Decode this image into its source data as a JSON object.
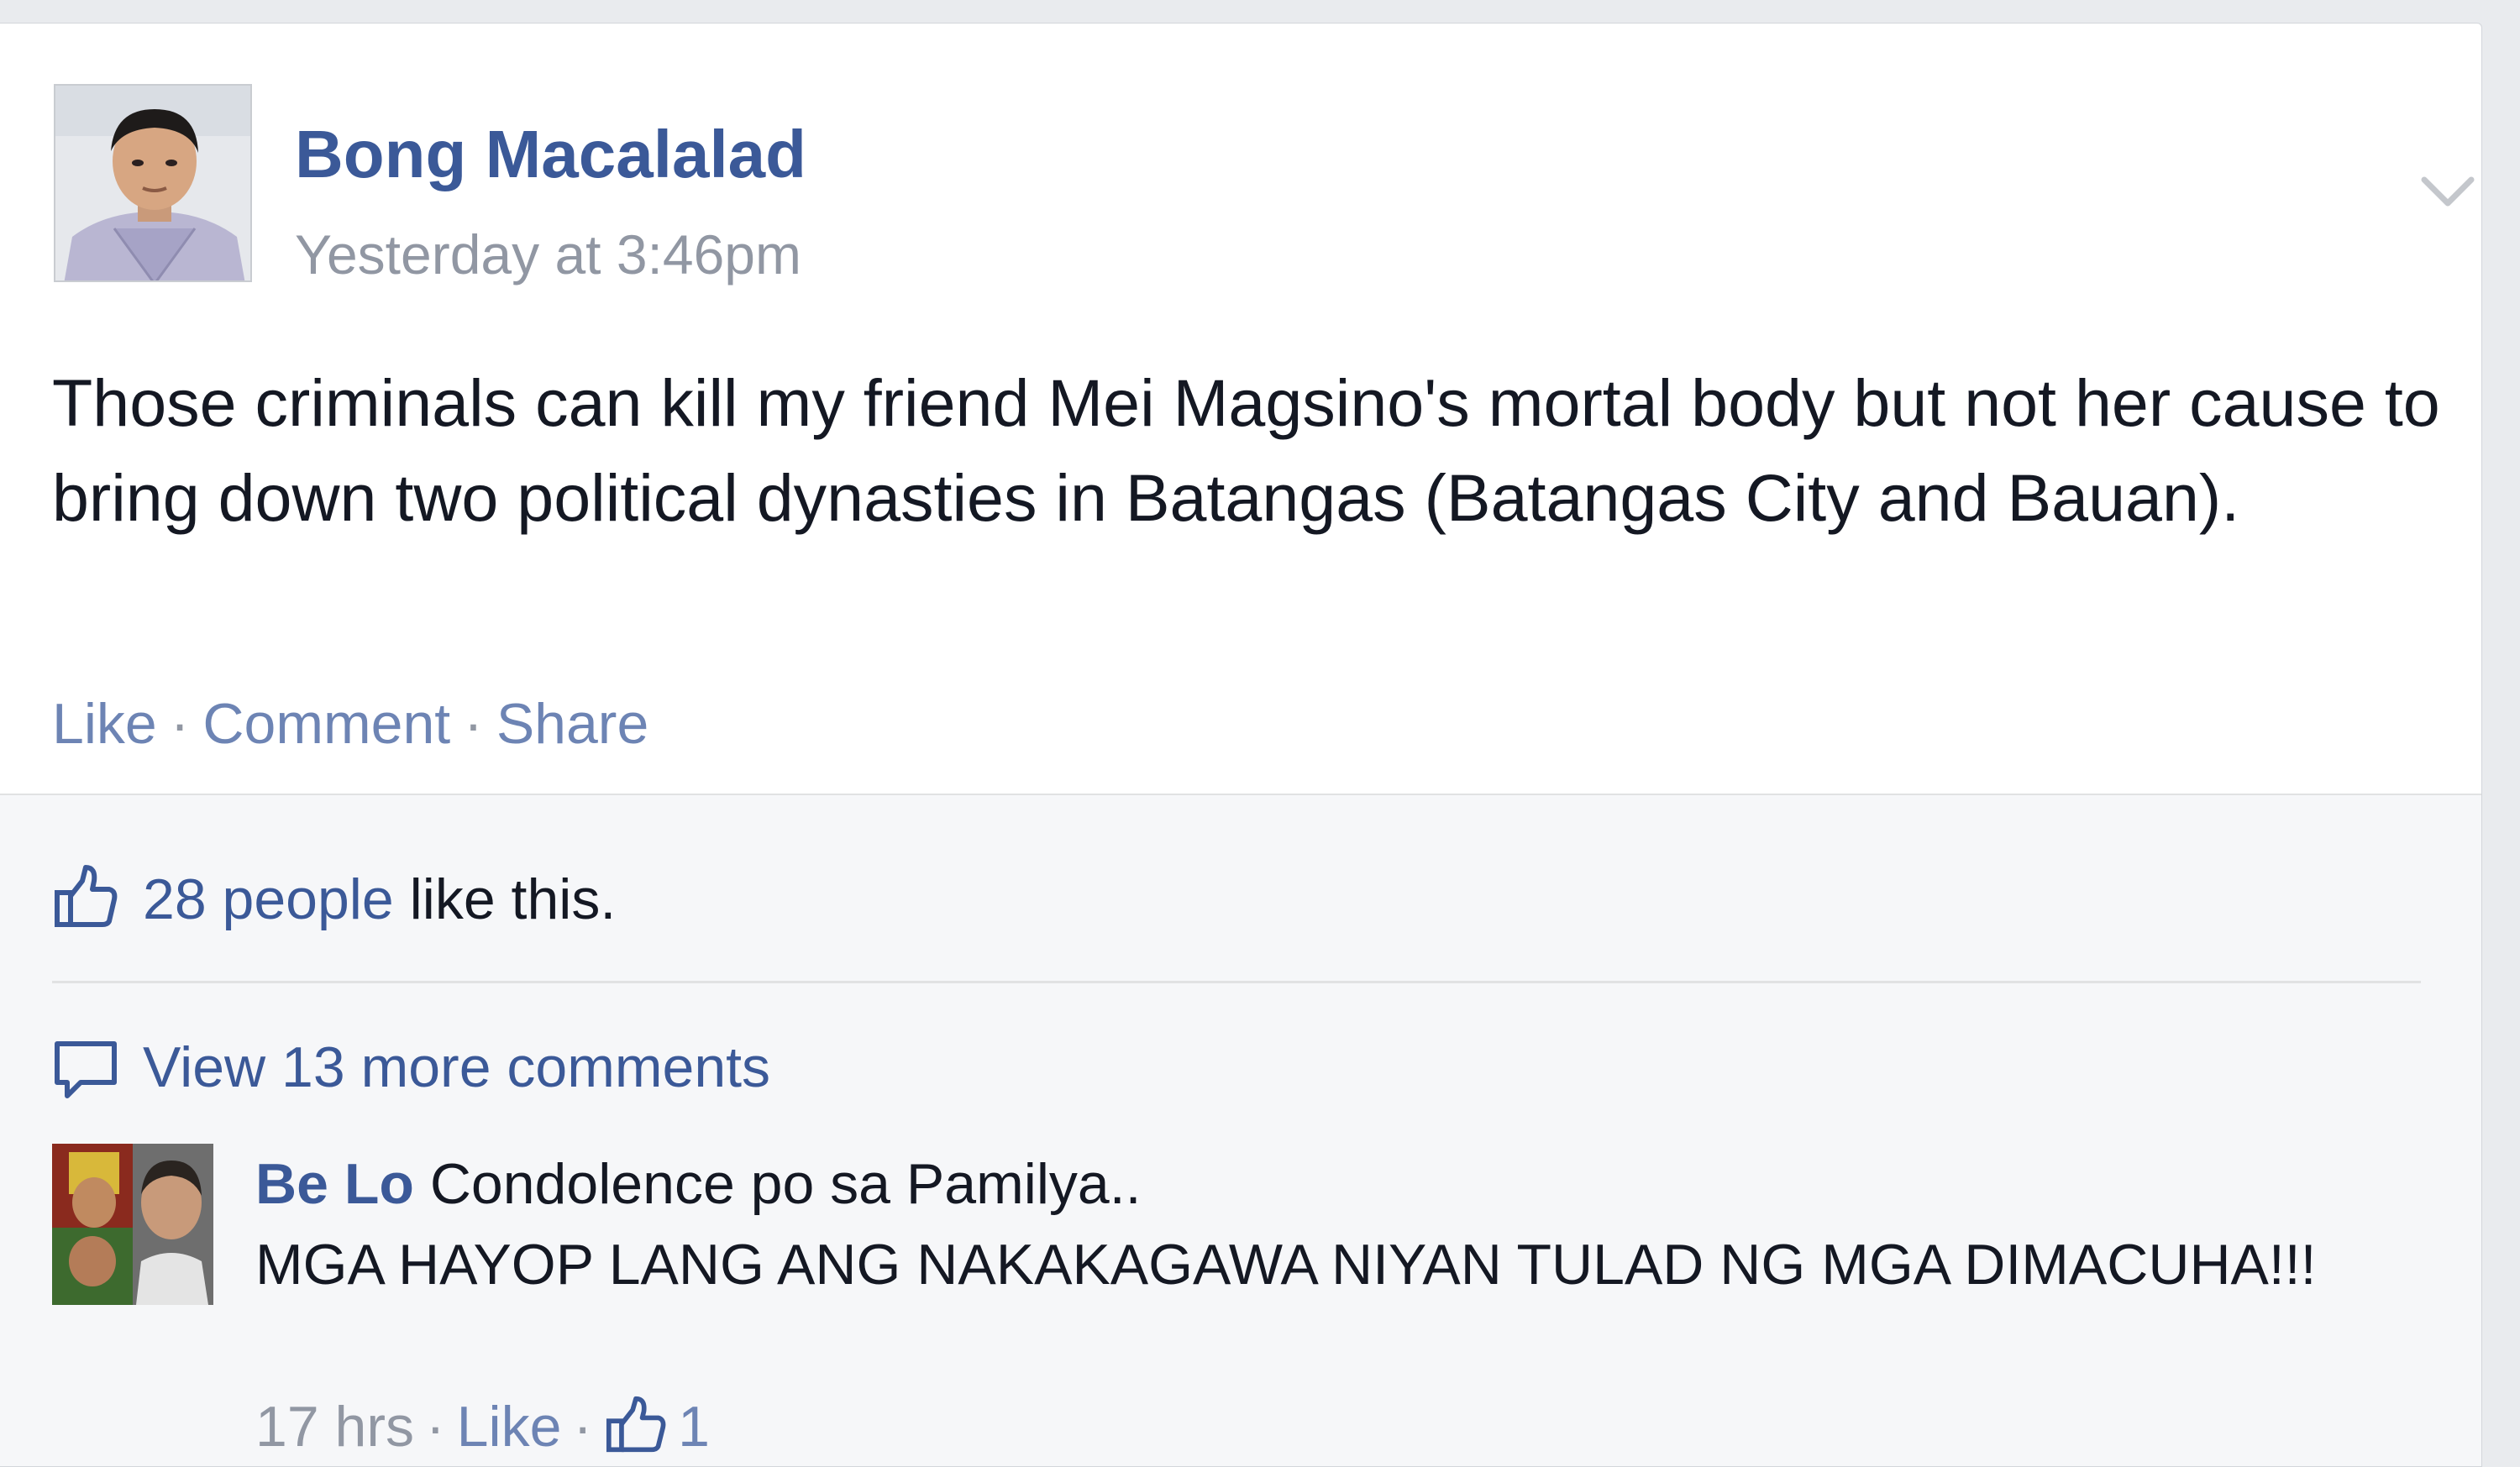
{
  "post": {
    "author": "Bong Macalalad",
    "timestamp": "Yesterday at 3:46pm",
    "text": "Those criminals can kill my friend Mei Magsino's mortal body but not her cause to bring down two political dynasties in Batangas (Batangas City and Bauan).",
    "actions": {
      "like": "Like",
      "comment": "Comment",
      "share": "Share",
      "separator": "·"
    },
    "menu_icon": "chevron-down-icon",
    "author_avatar_icon": "profile-photo"
  },
  "feedback": {
    "likes_count_text": "28 people",
    "likes_suffix": " like this.",
    "like_icon": "thumbs-up-icon",
    "view_more_text": "View 13 more comments",
    "view_more_icon": "comment-bubble-icon"
  },
  "comments": [
    {
      "author": "Be Lo",
      "text_line1": "Condolence po sa Pamilya..",
      "text_rest": "MGA HAYOP LANG ANG NAKAKAGAWA NIYAN TULAD NG MGA DIMACUHA!!!",
      "time": "17 hrs",
      "like_label": "Like",
      "like_count": "1",
      "separator": "·"
    }
  ],
  "colors": {
    "link_blue": "#3b5998",
    "action_blue": "#6d84b4",
    "meta_gray": "#9197a3",
    "text_dark": "#141823",
    "feedback_bg": "#f6f7f9",
    "page_bg": "#e9ebee"
  }
}
